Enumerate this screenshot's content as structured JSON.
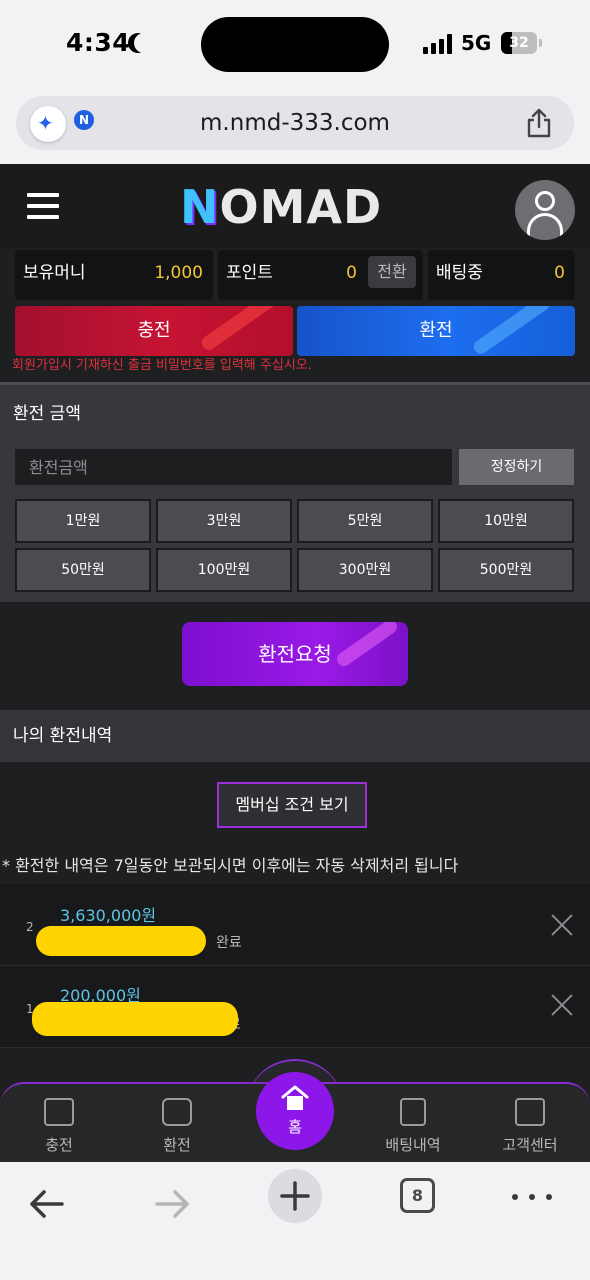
{
  "status_bar": {
    "time": "4:34",
    "network": "5G",
    "battery": "32"
  },
  "browser": {
    "url": "m.nmd-333.com",
    "ai_badge": "N"
  },
  "header": {
    "logo_first": "N",
    "logo_rest": "OMAD"
  },
  "balances": [
    {
      "label": "보유머니",
      "value": "1,000"
    },
    {
      "label": "포인트",
      "value": "0",
      "action": "전환"
    },
    {
      "label": "배팅중",
      "value": "0"
    }
  ],
  "actions": {
    "deposit": "충전",
    "withdraw": "환전"
  },
  "notice": "회원가입시 기재하신 출금 비밀번호를 입력해 주십시오.",
  "withdraw_panel": {
    "title": "환전 금액",
    "input_placeholder": "환전금액",
    "correct_button": "정정하기",
    "chips": [
      "1만원",
      "3만원",
      "5만원",
      "10만원",
      "50만원",
      "100만원",
      "300만원",
      "500만원"
    ],
    "request_button": "환전요청"
  },
  "history": {
    "title": "나의 환전내역",
    "membership_button": "멤버십 조건 보기",
    "note": "* 환전한 내역은 7일동안 보관되시면 이후에는 자동 삭제처리 됩니다",
    "items": [
      {
        "index": "2",
        "amount": "3,630,000원",
        "status": "완료"
      },
      {
        "index": "1",
        "amount": "200,000원",
        "status": "료"
      }
    ]
  },
  "bottom_nav": {
    "deposit": "충전",
    "withdraw": "환전",
    "home": "홈",
    "betting_history": "배팅내역",
    "support": "고객센터"
  },
  "toolbar": {
    "tab_count": "8"
  },
  "colors": {
    "accent_purple": "#8d16e8",
    "deposit_red": "#c61433",
    "withdraw_blue": "#1d6ef0",
    "value_yellow": "#f2c534",
    "amount_cyan": "#5fc3e8"
  }
}
